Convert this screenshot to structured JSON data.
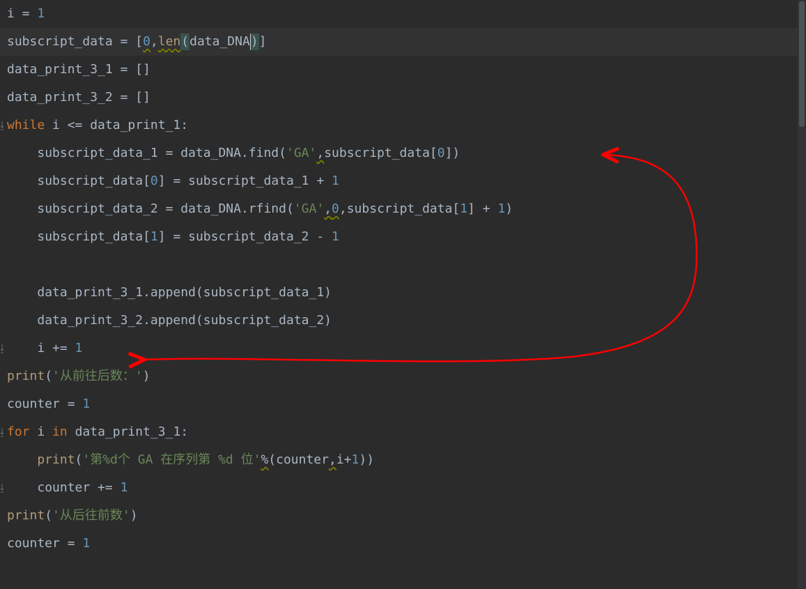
{
  "code": {
    "lines": [
      {
        "indent": 0,
        "hl": false,
        "tokens": [
          {
            "t": "i ",
            "c": "op"
          },
          {
            "t": "= ",
            "c": "op"
          },
          {
            "t": "1",
            "c": "num"
          }
        ]
      },
      {
        "indent": 0,
        "hl": true,
        "tokens": [
          {
            "t": "subscript_data ",
            "c": "op"
          },
          {
            "t": "= [",
            "c": "op"
          },
          {
            "t": "0",
            "c": "num",
            "warn": true
          },
          {
            "t": ",",
            "c": "op"
          },
          {
            "t": "len",
            "c": "fn",
            "warn": true
          },
          {
            "t": "(",
            "c": "op",
            "paren": true
          },
          {
            "t": "data_DNA",
            "c": "op"
          },
          {
            "t": ")",
            "c": "op",
            "paren": true,
            "caret": true
          },
          {
            "t": "]",
            "c": "op"
          }
        ]
      },
      {
        "indent": 0,
        "tokens": [
          {
            "t": "data_print_3_1 ",
            "c": "op"
          },
          {
            "t": "= []",
            "c": "op"
          }
        ]
      },
      {
        "indent": 0,
        "tokens": [
          {
            "t": "data_print_3_2 ",
            "c": "op"
          },
          {
            "t": "= []",
            "c": "op"
          }
        ]
      },
      {
        "indent": 0,
        "gutter": "ret",
        "tokens": [
          {
            "t": "while ",
            "c": "kw"
          },
          {
            "t": "i <= data_print_1:",
            "c": "op"
          }
        ]
      },
      {
        "indent": 1,
        "tokens": [
          {
            "t": "subscript_data_1 = data_DNA.find(",
            "c": "op"
          },
          {
            "t": "'GA'",
            "c": "str"
          },
          {
            "t": ",",
            "c": "op",
            "warn": true
          },
          {
            "t": "subscript_data[",
            "c": "op"
          },
          {
            "t": "0",
            "c": "num"
          },
          {
            "t": "])",
            "c": "op"
          }
        ]
      },
      {
        "indent": 1,
        "tokens": [
          {
            "t": "subscript_data[",
            "c": "op"
          },
          {
            "t": "0",
            "c": "num"
          },
          {
            "t": "] = subscript_data_1 + ",
            "c": "op"
          },
          {
            "t": "1",
            "c": "num"
          }
        ]
      },
      {
        "indent": 1,
        "tokens": [
          {
            "t": "subscript_data_2 = data_DNA.rfind(",
            "c": "op"
          },
          {
            "t": "'GA'",
            "c": "str"
          },
          {
            "t": ",",
            "c": "op",
            "warn": true
          },
          {
            "t": "0",
            "c": "num",
            "warn": true
          },
          {
            "t": ",",
            "c": "op"
          },
          {
            "t": "subscript_data[",
            "c": "op"
          },
          {
            "t": "1",
            "c": "num"
          },
          {
            "t": "] + ",
            "c": "op"
          },
          {
            "t": "1",
            "c": "num"
          },
          {
            "t": ")",
            "c": "op"
          }
        ]
      },
      {
        "indent": 1,
        "tokens": [
          {
            "t": "subscript_data[",
            "c": "op"
          },
          {
            "t": "1",
            "c": "num"
          },
          {
            "t": "] = subscript_data_2 - ",
            "c": "op"
          },
          {
            "t": "1",
            "c": "num"
          }
        ]
      },
      {
        "indent": 0,
        "tokens": []
      },
      {
        "indent": 1,
        "tokens": [
          {
            "t": "data_print_3_1.append(subscript_data_1)",
            "c": "op"
          }
        ]
      },
      {
        "indent": 1,
        "tokens": [
          {
            "t": "data_print_3_2.append(subscript_data_2)",
            "c": "op"
          }
        ]
      },
      {
        "indent": 1,
        "gutter": "ret",
        "tokens": [
          {
            "t": "i += ",
            "c": "op"
          },
          {
            "t": "1",
            "c": "num"
          }
        ]
      },
      {
        "indent": 0,
        "tokens": [
          {
            "t": "print",
            "c": "fn"
          },
          {
            "t": "(",
            "c": "op"
          },
          {
            "t": "'从前往后数：'",
            "c": "str"
          },
          {
            "t": ")",
            "c": "op"
          }
        ]
      },
      {
        "indent": 0,
        "tokens": [
          {
            "t": "counter = ",
            "c": "op"
          },
          {
            "t": "1",
            "c": "num"
          }
        ]
      },
      {
        "indent": 0,
        "gutter": "ret",
        "tokens": [
          {
            "t": "for ",
            "c": "kw"
          },
          {
            "t": "i ",
            "c": "op"
          },
          {
            "t": "in ",
            "c": "kw"
          },
          {
            "t": "data_print_3_1:",
            "c": "op"
          }
        ]
      },
      {
        "indent": 1,
        "tokens": [
          {
            "t": "print",
            "c": "fn"
          },
          {
            "t": "(",
            "c": "op"
          },
          {
            "t": "'第%d个 GA 在序列第 %d 位'",
            "c": "str"
          },
          {
            "t": "%",
            "c": "op",
            "warn": true
          },
          {
            "t": "(counter",
            "c": "op"
          },
          {
            "t": ",",
            "c": "op",
            "warn": true
          },
          {
            "t": "i+",
            "c": "op"
          },
          {
            "t": "1",
            "c": "num"
          },
          {
            "t": "))",
            "c": "op"
          }
        ]
      },
      {
        "indent": 1,
        "gutter": "ret",
        "tokens": [
          {
            "t": "counter += ",
            "c": "op"
          },
          {
            "t": "1",
            "c": "num"
          }
        ]
      },
      {
        "indent": 0,
        "tokens": [
          {
            "t": "print",
            "c": "fn"
          },
          {
            "t": "(",
            "c": "op"
          },
          {
            "t": "'从后往前数'",
            "c": "str"
          },
          {
            "t": ")",
            "c": "op"
          }
        ]
      },
      {
        "indent": 0,
        "tokens": [
          {
            "t": "counter = ",
            "c": "op"
          },
          {
            "t": "1",
            "c": "num"
          }
        ]
      }
    ]
  },
  "colors": {
    "keyword": "#cc7832",
    "number": "#6897bb",
    "string": "#6a8759",
    "builtin": "#b09d79",
    "default": "#a9b7c6",
    "bg": "#2b2b2b",
    "highlight_line": "#323232",
    "annotation": "#ff0000"
  },
  "annotation": {
    "type": "curved-arrow",
    "from": {
      "line": 5,
      "col_desc": "end of subscript_data[0]) on find line"
    },
    "to": {
      "line": 12,
      "col_desc": "after 'i += 1'"
    },
    "color": "#ff0000"
  }
}
